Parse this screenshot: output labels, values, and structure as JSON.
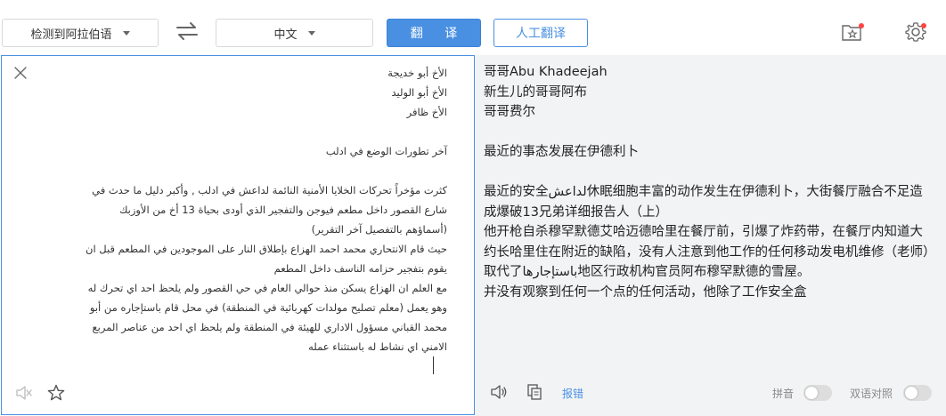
{
  "toolbar": {
    "source_language": "检测到阿拉伯语",
    "target_language": "中文",
    "translate_button": "翻 译",
    "human_translate_button": "人工翻译"
  },
  "source": {
    "lines": [
      "الأخ أبو خديجة",
      "الأخ أبو الوليد",
      "الأخ ظافر",
      "",
      "آخر تطورات الوضع في ادلب",
      "",
      "كثرت مؤخراً تحركات الخلايا الأمنية النائمة لداعش في ادلب , وأكبر دليل ما حدث في",
      "شارع القصور داخل مطعم فيوجن والتفجير الذي أودى بحياة 13 أخ من الأوزبك",
      "(أسماؤهم بالتفصيل آخر التقرير)",
      "حيث قام الانتحاري محمد احمد الهزاع بإطلاق النار على الموجودين في المطعم قبل ان",
      "يقوم بتفجير حزامه الناسف داخل المطعم",
      "مع العلم ان الهزاع يسكن منذ حوالي العام في حي القصور ولم يلحظ احد اي تحرك له",
      "وهو يعمل (معلم تصليح مولدات كهربائية في المنطقة) في محل قام باستإجاره من أبو",
      "محمد القباني مسؤول الاداري للهيئة في المنطقة ولم يلحظ اي احد من عناصر المربع",
      "الامني اي نشاط له باستثناء عمله"
    ]
  },
  "target": {
    "lines": [
      "哥哥Abu Khadeejah",
      "新生儿的哥哥阿布",
      "哥哥费尔",
      "",
      "最近的事态发展在伊德利卜",
      "",
      "最近的安全لداعش休眠细胞丰富的动作发生在伊德利卜，大街餐厅融合不足造成爆破13兄弟详细报告人（上）",
      "他开枪自杀穆罕默德艾哈迈德哈里在餐厅前，引爆了炸药带，在餐厅内知道大约长哈里住在附近的缺陷，没有人注意到他工作的任何移动发电机维修（老师）取代了باستإجارها地区行政机构官员阿布穆罕默德的雪屋。",
      "并没有观察到任何一个点的任何活动，他除了工作安全盒"
    ],
    "report_link": "报错",
    "pinyin_label": "拼音",
    "bilingual_label": "双语对照"
  },
  "colors": {
    "accent": "#4a90e2",
    "panel_bg": "#f2f3f5",
    "badge": "#ff4444"
  }
}
